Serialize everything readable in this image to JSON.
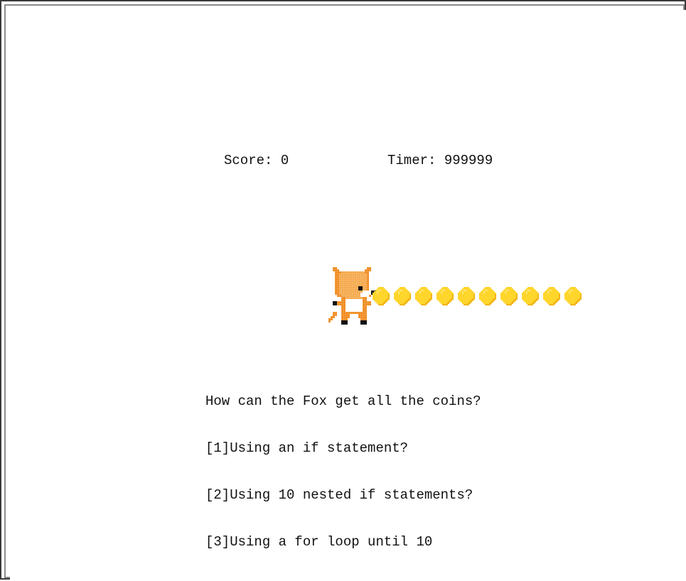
{
  "hud": {
    "score_text": "Score: 0",
    "timer_text": "Timer: 999999"
  },
  "sprites": {
    "player": "fox-icon",
    "coin": "coin-icon",
    "coin_count": 10
  },
  "colors": {
    "fox_orange": "#f08a1c",
    "fox_light": "#f5a84a",
    "fox_white": "#ffffff",
    "fox_black": "#111111",
    "coin_yellow": "#ffd21a",
    "coin_dark": "#f0b000",
    "coin_light": "#ffe66b"
  },
  "quiz": {
    "question": "How can the Fox get all the coins?",
    "options": [
      "[1]Using an if statement?",
      "[2]Using 10 nested if statements?",
      "[3]Using a for loop until 10"
    ]
  }
}
